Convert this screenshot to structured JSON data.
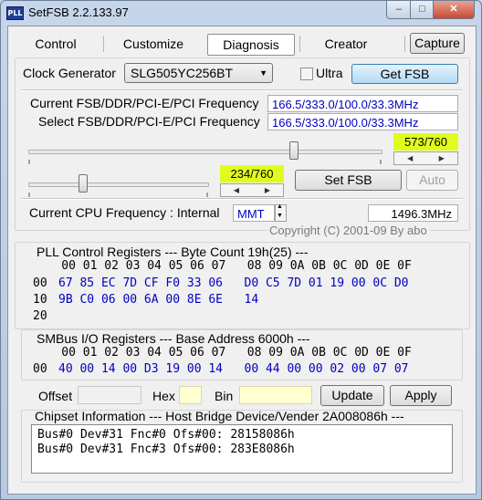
{
  "window": {
    "title": "SetFSB 2.2.133.97",
    "icon_text": "PLL",
    "min_glyph": "–",
    "max_glyph": "□",
    "close_glyph": "✕"
  },
  "tabs": [
    {
      "label": "Control"
    },
    {
      "label": "Customize"
    },
    {
      "label": "Diagnosis"
    },
    {
      "label": "Creator"
    }
  ],
  "capture_label": "Capture",
  "clock_generator": {
    "label": "Clock Generator",
    "value": "SLG505YC256BT",
    "ultra_label": "Ultra",
    "ultra_checked": false,
    "get_fsb_label": "Get FSB"
  },
  "frequencies": {
    "current_label": "Current FSB/DDR/PCI-E/PCI Frequency",
    "current_value": "166.5/333.0/100.0/33.3MHz",
    "select_label": "Select FSB/DDR/PCI-E/PCI Frequency",
    "select_value": "166.5/333.0/100.0/33.3MHz"
  },
  "sliders": {
    "main_counter": "573/760",
    "main_level": 0.754,
    "secondary_counter": "234/760",
    "secondary_level": 0.308
  },
  "buttons": {
    "set_fsb": "Set FSB",
    "auto": "Auto",
    "update": "Update",
    "apply": "Apply"
  },
  "cpu": {
    "label": "Current CPU Frequency : Internal",
    "mode": "MMT",
    "value": "1496.3MHz"
  },
  "copyright": "Copyright (C) 2001-09 By abo",
  "pll": {
    "header": "PLL Control Registers  --- Byte Count 19h(25) ---",
    "col_header": "    00 01 02 03 04 05 06 07   08 09 0A 0B 0C 0D 0E 0F",
    "rows": [
      {
        "addr": "00",
        "data": "67 85 EC 7D CF F0 33 06   D0 C5 7D 01 19 00 0C D0"
      },
      {
        "addr": "10",
        "data": "9B C0 06 00 6A 00 8E 6E   14"
      },
      {
        "addr": "20",
        "data": ""
      }
    ]
  },
  "smbus": {
    "header": "SMBus I/O Registers  --- Base Address 6000h ---",
    "col_header": "    00 01 02 03 04 05 06 07   08 09 0A 0B 0C 0D 0E 0F",
    "rows": [
      {
        "addr": "00",
        "data": "40 00 14 00 D3 19 00 14   00 44 00 00 02 00 07 07"
      }
    ]
  },
  "edit": {
    "offset_label": "Offset",
    "offset_value": "",
    "hex_label": "Hex",
    "hex_value": "",
    "bin_label": "Bin",
    "bin_value": ""
  },
  "chipset": {
    "header": "Chipset Information  --- Host Bridge Device/Vender 2A008086h ---",
    "lines": [
      "Bus#0 Dev#31 Fnc#0 Ofs#00: 28158086h",
      "Bus#0 Dev#31 Fnc#3 Ofs#00: 283E8086h"
    ]
  },
  "colors": {
    "value_text": "#0000c0",
    "counter_bg": "#e1fb1f",
    "get_fsb_bg": "#b3daf5"
  }
}
